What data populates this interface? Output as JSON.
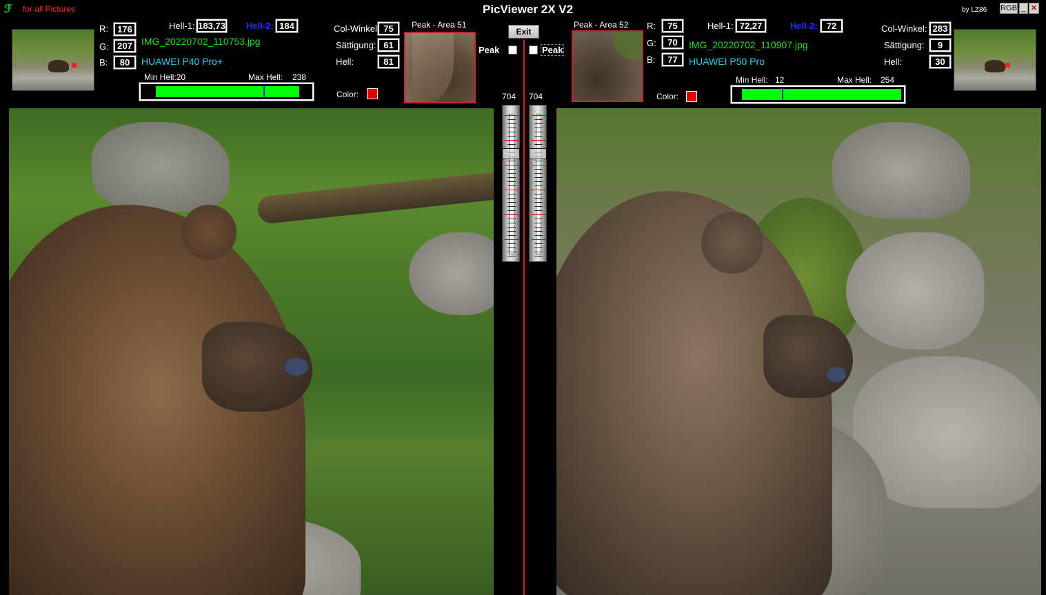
{
  "app": {
    "title": "PicViewer 2X V2",
    "logo_glyph": "ℱ",
    "tagline": "for all Pictures",
    "author": "by LZ86",
    "rgb_button": "RGB",
    "minimize_glyph": "_",
    "close_glyph": "✕",
    "exit_label": "Exit"
  },
  "left": {
    "r_label": "R:",
    "r": "176",
    "g_label": "G:",
    "g": "207",
    "b_label": "B:",
    "b": "80",
    "hell1_label": "Hell-1:",
    "hell1": "183,73",
    "hell2_label": "Hell-2:",
    "hell2": "184",
    "filename": "IMG_20220702_110753.jpg",
    "camera": "HUAWEI P40 Pro+",
    "min_label": "Min Hell:",
    "min": "20",
    "max_label": "Max Hell:",
    "max": "238",
    "col_winkel_label": "Col-Winkel",
    "col_winkel": "75",
    "saettigung_label": "Sättigung:",
    "saettigung": "61",
    "hell_label": "Hell:",
    "hell": "81",
    "color_label": "Color:",
    "peak_area_label": "Peak - Area 51",
    "peak_label": "Peak",
    "slider_value": "704",
    "bar_min": 20,
    "bar_max": 238,
    "bar_mark": 184
  },
  "right": {
    "r_label": "R:",
    "r": "75",
    "g_label": "G:",
    "g": "70",
    "b_label": "B:",
    "b": "77",
    "hell1_label": "Hell-1:",
    "hell1": "72,27",
    "hell2_label": "Hell-2:",
    "hell2": "72",
    "filename": "IMG_20220702_110907.jpg",
    "camera": "HUAWEI P50 Pro",
    "min_label": "Min Hell:",
    "min": "12",
    "max_label": "Max Hell:",
    "max": "254",
    "col_winkel_label": "Col-Winkel:",
    "col_winkel": "283",
    "saettigung_label": "Sättigung:",
    "saettigung": "9",
    "hell_label": "Hell:",
    "hell": "30",
    "color_label": "Color:",
    "peak_area_label": "Peak - Area 52",
    "peak_label": "Peak",
    "slider_value": "704",
    "bar_min": 12,
    "bar_max": 254,
    "bar_mark": 72
  },
  "colors": {
    "filename": "#22dd22",
    "camera": "#22ccee",
    "hell2_label": "#2233ff",
    "tagline": "#ff2a2a",
    "bar_fill": "#00ff00",
    "swatch": "#e00000",
    "divider": "#c8282c"
  }
}
